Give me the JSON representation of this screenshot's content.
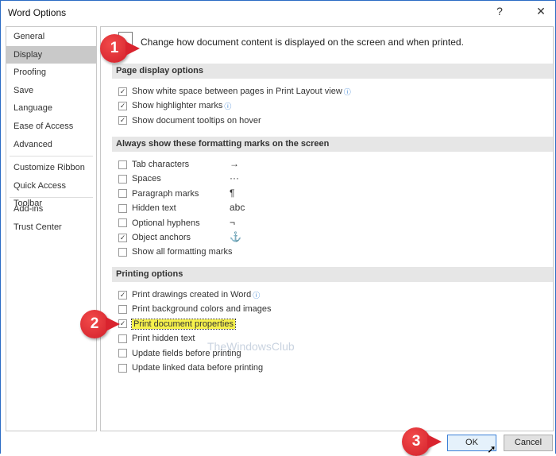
{
  "window": {
    "title": "Word Options",
    "help": "?",
    "close": "✕"
  },
  "sidebar": {
    "items": [
      {
        "label": "General"
      },
      {
        "label": "Display"
      },
      {
        "label": "Proofing"
      },
      {
        "label": "Save"
      },
      {
        "label": "Language"
      },
      {
        "label": "Ease of Access"
      },
      {
        "label": "Advanced"
      },
      {
        "label": "Customize Ribbon"
      },
      {
        "label": "Quick Access Toolbar"
      },
      {
        "label": "Add-ins"
      },
      {
        "label": "Trust Center"
      }
    ],
    "selected": "Display"
  },
  "content": {
    "intro": "Change how document content is displayed on the screen and when printed.",
    "sections": [
      {
        "title": "Page display options",
        "options": [
          {
            "label": "Show white space between pages in Print Layout view",
            "checked": true,
            "info": true
          },
          {
            "label": "Show highlighter marks",
            "checked": true,
            "info": true
          },
          {
            "label": "Show document tooltips on hover",
            "checked": true
          }
        ]
      },
      {
        "title": "Always show these formatting marks on the screen",
        "options": [
          {
            "label": "Tab characters",
            "checked": false,
            "mark": "→"
          },
          {
            "label": "Spaces",
            "checked": false,
            "mark": "···"
          },
          {
            "label": "Paragraph marks",
            "checked": false,
            "mark": "¶"
          },
          {
            "label": "Hidden text",
            "checked": false,
            "mark": "abc"
          },
          {
            "label": "Optional hyphens",
            "checked": false,
            "mark": "¬"
          },
          {
            "label": "Object anchors",
            "checked": true,
            "mark": "⚓"
          },
          {
            "label": "Show all formatting marks",
            "checked": false
          }
        ]
      },
      {
        "title": "Printing options",
        "options": [
          {
            "label": "Print drawings created in Word",
            "checked": true,
            "info": true
          },
          {
            "label": "Print background colors and images",
            "checked": false
          },
          {
            "label": "Print document properties",
            "checked": true
          },
          {
            "label": "Print hidden text",
            "checked": false
          },
          {
            "label": "Update fields before printing",
            "checked": false
          },
          {
            "label": "Update linked data before printing",
            "checked": false
          }
        ]
      }
    ]
  },
  "buttons": {
    "ok": "OK",
    "cancel": "Cancel"
  },
  "callouts": [
    "1",
    "2",
    "3"
  ],
  "watermark": "TheWindowsClub",
  "colors": {
    "callout": "#d9232e",
    "highlight": "#f6f14c",
    "selected": "#c9c9c9"
  }
}
